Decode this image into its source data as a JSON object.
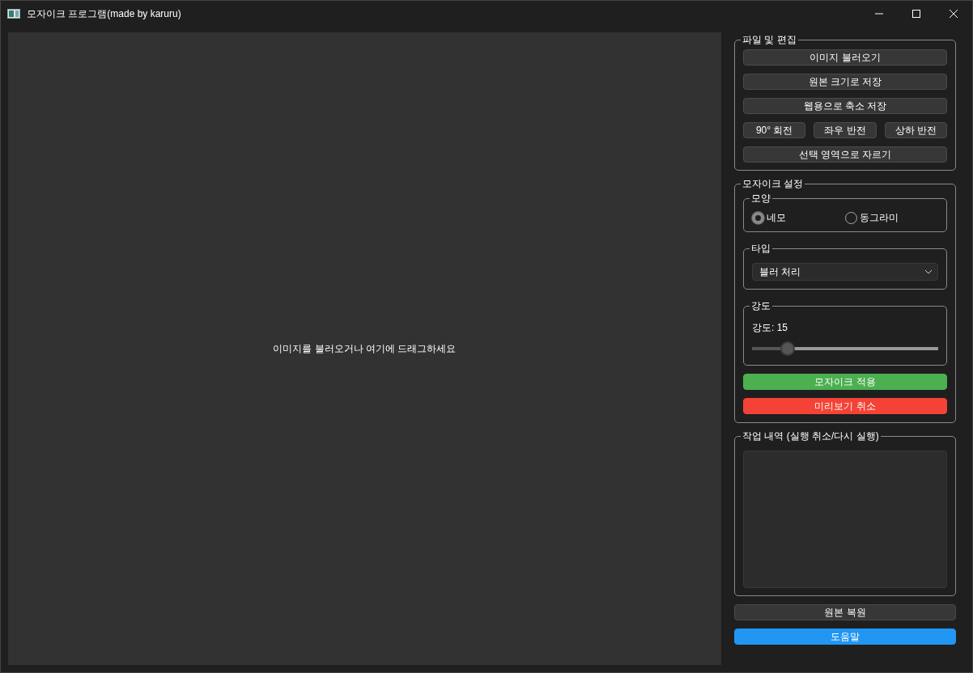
{
  "window": {
    "title": "모자이크 프로그램(made by karuru)"
  },
  "canvas": {
    "hint": "이미지를 불러오거나 여기에 드래그하세요"
  },
  "file_edit": {
    "title": "파일 및 편집",
    "rows": [
      [
        {
          "label": "이미지 불러오기"
        }
      ],
      [
        {
          "label": "원본 크기로 저장"
        }
      ],
      [
        {
          "label": "웹용으로 축소 저장"
        }
      ],
      [
        {
          "label": "90° 회전"
        },
        {
          "label": "좌우 반전"
        },
        {
          "label": "상하 반전"
        }
      ],
      [
        {
          "label": "선택 영역으로 자르기"
        }
      ]
    ]
  },
  "mosaic": {
    "title": "모자이크 설정",
    "shape": {
      "title": "모양",
      "options": [
        {
          "label": "네모",
          "selected": true
        },
        {
          "label": "동그라미",
          "selected": false
        }
      ]
    },
    "type": {
      "title": "타입",
      "value": "블러 처리"
    },
    "strength": {
      "title": "강도",
      "reading": "강도: 15",
      "level": 0.165
    },
    "buttons": [
      {
        "label": "모자이크 적용",
        "kind": "success"
      },
      {
        "label": "미리보기 취소",
        "kind": "danger"
      }
    ]
  },
  "history": {
    "title": "작업 내역 (실행 취소/다시 실행)"
  },
  "bottom_buttons": [
    {
      "label": "원본 복원",
      "kind": "default"
    },
    {
      "label": "도움말",
      "kind": "primary"
    }
  ]
}
